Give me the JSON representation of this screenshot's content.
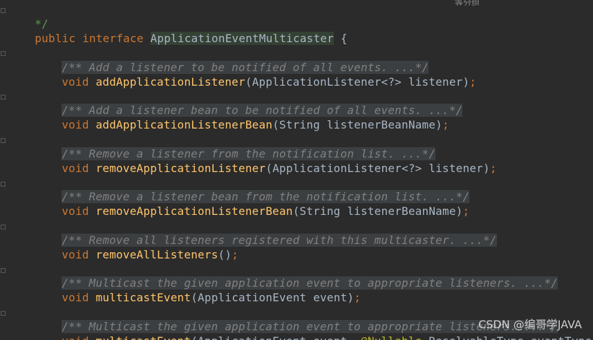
{
  "editor": {
    "top_overlay": "等分组",
    "watermark": "CSDN @编哥学JAVA",
    "lines": {
      "doc_end": "*/",
      "interface_keyword1": "public",
      "interface_keyword2": "interface",
      "interface_name": "ApplicationEventMulticaster",
      "open_brace": "{",
      "comment1": "/** Add a listener to be notified of all events. ...*/",
      "method1_return": "void",
      "method1_name": "addApplicationListener",
      "method1_params": "(ApplicationListener<?> listener)",
      "comment2": "/** Add a listener bean to be notified of all events. ...*/",
      "method2_return": "void",
      "method2_name": "addApplicationListenerBean",
      "method2_params": "(String listenerBeanName)",
      "comment3": "/** Remove a listener from the notification list. ...*/",
      "method3_return": "void",
      "method3_name": "removeApplicationListener",
      "method3_params": "(ApplicationListener<?> listener)",
      "comment4": "/** Remove a listener bean from the notification list. ...*/",
      "method4_return": "void",
      "method4_name": "removeApplicationListenerBean",
      "method4_params": "(String listenerBeanName)",
      "comment5": "/** Remove all listeners registered with this multicaster. ...*/",
      "method5_return": "void",
      "method5_name": "removeAllListeners",
      "method5_params": "()",
      "comment6": "/** Multicast the given application event to appropriate listeners. ...*/",
      "method6_return": "void",
      "method6_name": "multicastEvent",
      "method6_params": "(ApplicationEvent event)",
      "comment7": "/** Multicast the given application event to appropriate listeners. ...*/",
      "method7_return": "void",
      "method7_name": "multicastEvent",
      "method7_params_prefix": "(ApplicationEvent event, ",
      "method7_annotation": "@Nullable",
      "method7_params_suffix": " ResolvableType eventType);"
    },
    "semicolon": ";"
  }
}
